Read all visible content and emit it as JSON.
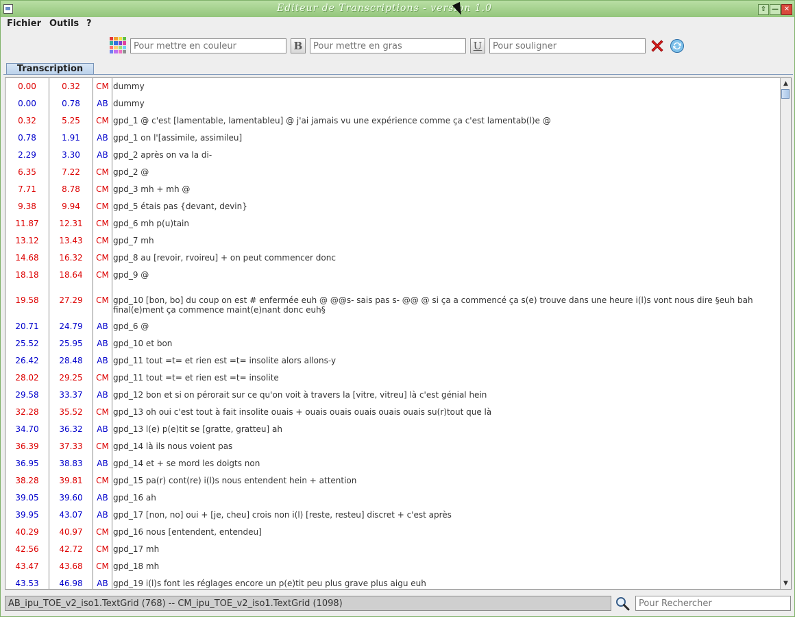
{
  "window": {
    "title": "Editeur de Transcriptions - version 1.0"
  },
  "menu": {
    "file": "Fichier",
    "tools": "Outils",
    "help": "?"
  },
  "toolbar": {
    "color_icon": "color-palette-icon",
    "color_placeholder": "Pour mettre en couleur",
    "bold_label": "B",
    "bold_placeholder": "Pour mettre en gras",
    "underline_label": "U",
    "underline_placeholder": "Pour souligner",
    "clear_icon": "red-x-icon",
    "refresh_icon": "refresh-icon"
  },
  "tab": {
    "label": "Transcription"
  },
  "colors": {
    "CM": "#dd0000",
    "AB": "#0000cc"
  },
  "rows": [
    {
      "start": "0.00",
      "end": "0.32",
      "speaker": "CM",
      "text": "dummy"
    },
    {
      "start": "0.00",
      "end": "0.78",
      "speaker": "AB",
      "text": "dummy"
    },
    {
      "start": "0.32",
      "end": "5.25",
      "speaker": "CM",
      "text": "gpd_1 @ c'est [lamentable, lamentableu] @ j'ai jamais vu une expérience comme ça c'est lamentab(l)e @"
    },
    {
      "start": "0.78",
      "end": "1.91",
      "speaker": "AB",
      "text": "gpd_1 on l'[assimile, assimileu]"
    },
    {
      "start": "2.29",
      "end": "3.30",
      "speaker": "AB",
      "text": "gpd_2 après on va la di-"
    },
    {
      "start": "6.35",
      "end": "7.22",
      "speaker": "CM",
      "text": "gpd_2 @"
    },
    {
      "start": "7.71",
      "end": "8.78",
      "speaker": "CM",
      "text": "gpd_3 mh + mh @"
    },
    {
      "start": "9.38",
      "end": "9.94",
      "speaker": "CM",
      "text": "gpd_5 étais pas {devant, devin}"
    },
    {
      "start": "11.87",
      "end": "12.31",
      "speaker": "CM",
      "text": "gpd_6 mh p(u)tain"
    },
    {
      "start": "13.12",
      "end": "13.43",
      "speaker": "CM",
      "text": "gpd_7 mh"
    },
    {
      "start": "14.68",
      "end": "16.32",
      "speaker": "CM",
      "text": "gpd_8 au [revoir, rvoireu] + on peut commencer donc"
    },
    {
      "start": "18.18",
      "end": "18.64",
      "speaker": "CM",
      "text": "gpd_9 @"
    },
    {
      "start": "19.58",
      "end": "27.29",
      "speaker": "CM",
      "text": "gpd_10 [bon, bo] du coup on est # enfermée euh @ @@s- sais pas s- @@ @ si ça a commencé ça s(e) trouve dans une heure i(l)s vont nous dire §euh bah final(e)ment ça commence maint(e)nant donc euh§",
      "tall": true
    },
    {
      "start": "20.71",
      "end": "24.79",
      "speaker": "AB",
      "text": "gpd_6 @"
    },
    {
      "start": "25.52",
      "end": "25.95",
      "speaker": "AB",
      "text": "gpd_10 et bon"
    },
    {
      "start": "26.42",
      "end": "28.48",
      "speaker": "AB",
      "text": "gpd_11 tout =t= et rien est =t= insolite alors allons-y"
    },
    {
      "start": "28.02",
      "end": "29.25",
      "speaker": "CM",
      "text": "gpd_11 tout =t= et rien est =t= insolite"
    },
    {
      "start": "29.58",
      "end": "33.37",
      "speaker": "AB",
      "text": "gpd_12 bon et si on pérorait sur ce qu'on voit à travers la [vitre, vitreu] là c'est génial hein"
    },
    {
      "start": "32.28",
      "end": "35.52",
      "speaker": "CM",
      "text": "gpd_13 oh oui c'est tout à fait insolite ouais + ouais ouais ouais ouais ouais su(r)tout que là"
    },
    {
      "start": "34.70",
      "end": "36.32",
      "speaker": "AB",
      "text": "gpd_13 l(e) p(e)tit se [gratte, gratteu] ah"
    },
    {
      "start": "36.39",
      "end": "37.33",
      "speaker": "CM",
      "text": "gpd_14 là ils nous voient pas"
    },
    {
      "start": "36.95",
      "end": "38.83",
      "speaker": "AB",
      "text": "gpd_14 et + se mord les doigts non"
    },
    {
      "start": "38.28",
      "end": "39.81",
      "speaker": "CM",
      "text": "gpd_15 pa(r) cont(re) i(l)s nous entendent hein + attention"
    },
    {
      "start": "39.05",
      "end": "39.60",
      "speaker": "AB",
      "text": "gpd_16 ah"
    },
    {
      "start": "39.95",
      "end": "43.07",
      "speaker": "AB",
      "text": "gpd_17 [non, no] oui + [je, cheu] crois non i(l) [reste, resteu] discret + c'est après"
    },
    {
      "start": "40.29",
      "end": "40.97",
      "speaker": "CM",
      "text": "gpd_16 nous [entendent, entendeu]"
    },
    {
      "start": "42.56",
      "end": "42.72",
      "speaker": "CM",
      "text": "gpd_17 mh"
    },
    {
      "start": "43.47",
      "end": "43.68",
      "speaker": "CM",
      "text": "gpd_18 mh"
    },
    {
      "start": "43.53",
      "end": "46.98",
      "speaker": "AB",
      "text": "gpd_19 i(l)s font les réglages encore un p(e)tit peu plus grave plus aigu euh"
    }
  ],
  "status": {
    "text": "AB_ipu_TOE_v2_iso1.TextGrid (768) -- CM_ipu_TOE_v2_iso1.TextGrid (1098)",
    "search_icon": "magnifier-icon",
    "search_placeholder": "Pour Rechercher"
  }
}
